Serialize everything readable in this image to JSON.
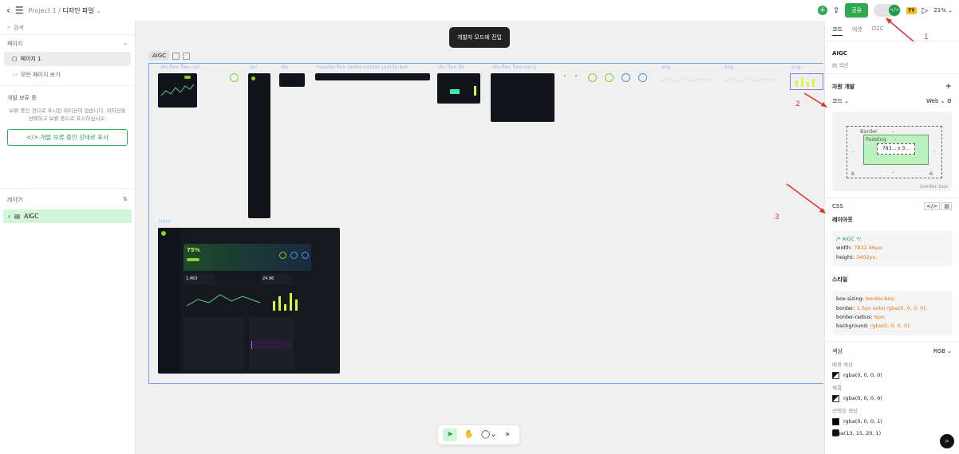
{
  "topbar": {
    "project": "Project 1",
    "separator": "/",
    "file": "디자인 파일",
    "plus_label": "+",
    "share_label": "공유",
    "dev_toggle_label": "</>",
    "user_initials": "TY",
    "zoom": "21%"
  },
  "left": {
    "search_placeholder": "검색",
    "pages_header": "페이지",
    "pages": [
      {
        "label": "페이지 1"
      },
      {
        "label": "모든 페이지 보기"
      }
    ],
    "pending_header": "개발 보류 중",
    "pending_text": "보류 중인 것으로 표시된 파티션이 없습니다. 파티션을 선택하고 보류 중으로 표시하십시오.",
    "pending_button": "</> 개발 보류 중인 상태로 표시",
    "layers_header": "레이어",
    "layer_item": "AIGC"
  },
  "canvas": {
    "toast": "개발자 모드에 진입",
    "frame_tag": "AIGC",
    "labels": {
      "c1": "div.flex flex-col",
      "c2": "asi",
      "c3": "div.",
      "c4": "header.flex items-center justify-bet",
      "c5": "div.flex flo",
      "c6": "div.flex flex-col g",
      "c7": "svg",
      "c8": "svg",
      "c9": "svg",
      "html": "html"
    },
    "preview_texts": {
      "percent": "75%",
      "kpi": "1,463",
      "kpi2": "24.96"
    }
  },
  "right": {
    "tabs": [
      "코드",
      "에셋",
      "D2C"
    ],
    "layer_name": "AIGC",
    "layer_type": "섹션",
    "assets_header": "자원 개발",
    "code_label": "코드",
    "web_label": "Web",
    "boxmodel": {
      "margin_top": "6",
      "margin_right": "6",
      "margin_bottom_left": "6",
      "margin_bottom_right": "6",
      "border_label": "Border",
      "border_value": "-",
      "padding_label": "Padding",
      "padding_value": "-",
      "content_size": "783... x 3...",
      "side_dash": "-",
      "box_sizing": "border-box"
    },
    "css_header": "CSS",
    "layout_header": "레이아웃",
    "layout_code": {
      "comment": "/* AIGC */",
      "width_key": "width:",
      "width_val": "7832.46px;",
      "height_key": "height:",
      "height_val": "3402px;"
    },
    "style_header": "스타일",
    "style_code": [
      {
        "k": "box-sizing:",
        "v": "border-box;"
      },
      {
        "k": "border:",
        "v": "1.5px solid rgba(0, 0, 0, 0);"
      },
      {
        "k": "border-radius:",
        "v": "6px;"
      },
      {
        "k": "background:",
        "v": "rgba(0, 0, 0, 0);"
      }
    ],
    "color_header": "색상",
    "color_mode": "RGB",
    "color_groups": [
      {
        "label": "배경 색상",
        "value": "rgba(0, 0, 0, 0)"
      },
      {
        "label": "채결",
        "value": "rgba(0, 0, 0, 0)"
      },
      {
        "label": "선택된 색상",
        "value": "rgba(0, 0, 0, 1)"
      },
      {
        "label": "",
        "value": "rgba(13, 15, 20, 1)"
      }
    ]
  },
  "annotations": [
    "1",
    "2",
    "3"
  ],
  "colors": {
    "accent": "#2fa84f",
    "selection": "#7aa3ef",
    "annotation": "#e0322b",
    "dark_ui": "#111418",
    "lime": "#8ad02e"
  }
}
